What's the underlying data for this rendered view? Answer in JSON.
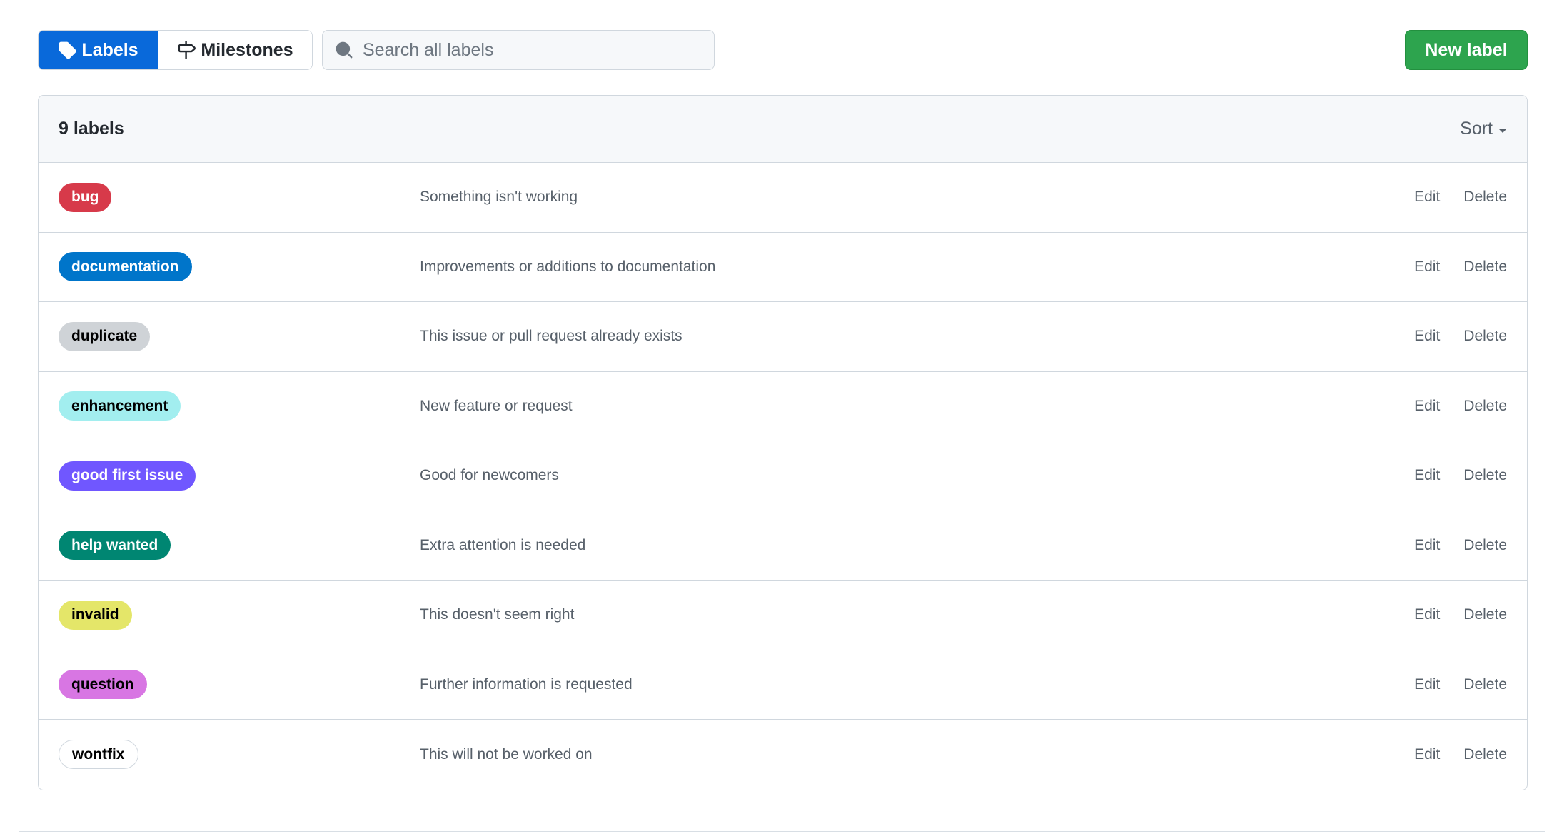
{
  "nav": {
    "labels_tab": "Labels",
    "milestones_tab": "Milestones",
    "labels_icon": "tag-icon",
    "milestones_icon": "milestone-icon"
  },
  "search": {
    "placeholder": "Search all labels",
    "value": "",
    "icon": "search-icon"
  },
  "new_label_button": "New label",
  "box": {
    "count_text": "9 labels",
    "sort_label": "Sort"
  },
  "actions": {
    "edit": "Edit",
    "delete": "Delete"
  },
  "labels": [
    {
      "name": "bug",
      "description": "Something isn't working",
      "bg": "#d73a4a",
      "fg": "#ffffff"
    },
    {
      "name": "documentation",
      "description": "Improvements or additions to documentation",
      "bg": "#0075ca",
      "fg": "#ffffff"
    },
    {
      "name": "duplicate",
      "description": "This issue or pull request already exists",
      "bg": "#cfd3d7",
      "fg": "#000000"
    },
    {
      "name": "enhancement",
      "description": "New feature or request",
      "bg": "#a2eeef",
      "fg": "#000000"
    },
    {
      "name": "good first issue",
      "description": "Good for newcomers",
      "bg": "#7057ff",
      "fg": "#ffffff"
    },
    {
      "name": "help wanted",
      "description": "Extra attention is needed",
      "bg": "#008672",
      "fg": "#ffffff"
    },
    {
      "name": "invalid",
      "description": "This doesn't seem right",
      "bg": "#e4e669",
      "fg": "#000000"
    },
    {
      "name": "question",
      "description": "Further information is requested",
      "bg": "#d876e3",
      "fg": "#000000"
    },
    {
      "name": "wontfix",
      "description": "This will not be worked on",
      "bg": "#ffffff",
      "fg": "#000000"
    }
  ],
  "colors": {
    "primary_blue": "#0969da",
    "success_green": "#2da44e",
    "border": "#d0d7de",
    "muted_text": "#57606a"
  }
}
